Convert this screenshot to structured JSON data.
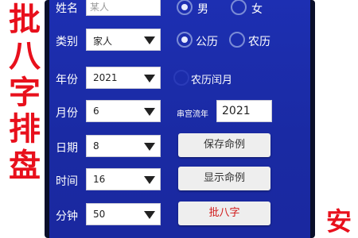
{
  "left_banner": [
    "批",
    "八",
    "字",
    "排",
    "盘"
  ],
  "right_banner": "安",
  "form": {
    "name_label": "姓名",
    "name_placeholder": "某人",
    "gender_male": "男",
    "gender_female": "女",
    "category_label": "类别",
    "category_value": "家人",
    "calendar_gregorian": "公历",
    "calendar_lunar": "农历",
    "year_label": "年份",
    "year_value": "2021",
    "lunar_leap": "农历闰月",
    "month_label": "月份",
    "month_value": "6",
    "palace_label": "串宫流年",
    "palace_year": "2021",
    "day_label": "日期",
    "day_value": "8",
    "save_button": "保存命例",
    "time_label": "时间",
    "time_value": "16",
    "show_button": "显示命例",
    "minute_label": "分钟",
    "minute_value": "50",
    "bazi_button": "批八字"
  }
}
